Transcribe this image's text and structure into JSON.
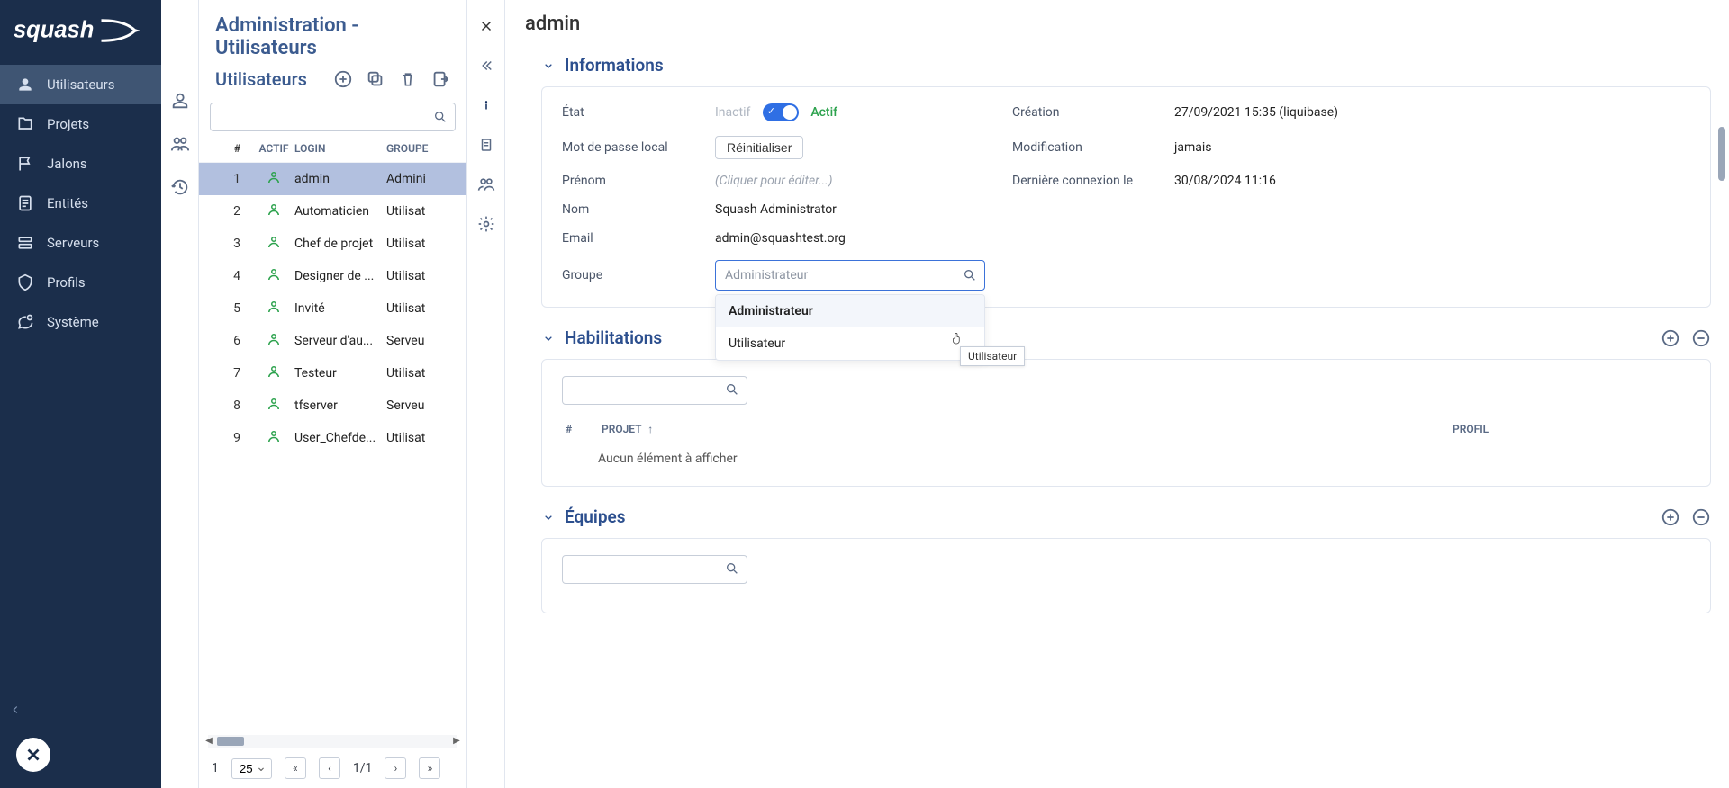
{
  "nav": {
    "items": [
      {
        "label": "Utilisateurs",
        "active": true
      },
      {
        "label": "Projets"
      },
      {
        "label": "Jalons"
      },
      {
        "label": "Entités"
      },
      {
        "label": "Serveurs"
      },
      {
        "label": "Profils"
      },
      {
        "label": "Système"
      }
    ]
  },
  "list": {
    "title": "Administration - Utilisateurs",
    "subtitle": "Utilisateurs",
    "columns": {
      "num": "#",
      "actif": "ACTIF",
      "login": "LOGIN",
      "groupe": "GROUPE"
    },
    "rows": [
      {
        "n": "1",
        "login": "admin",
        "groupe": "Admini",
        "selected": true
      },
      {
        "n": "2",
        "login": "Automaticien",
        "groupe": "Utilisat"
      },
      {
        "n": "3",
        "login": "Chef de projet",
        "groupe": "Utilisat"
      },
      {
        "n": "4",
        "login": "Designer de ...",
        "groupe": "Utilisat"
      },
      {
        "n": "5",
        "login": "Invité",
        "groupe": "Utilisat"
      },
      {
        "n": "6",
        "login": "Serveur d'au...",
        "groupe": "Serveu"
      },
      {
        "n": "7",
        "login": "Testeur",
        "groupe": "Utilisat"
      },
      {
        "n": "8",
        "login": "tfserver",
        "groupe": "Serveu"
      },
      {
        "n": "9",
        "login": "User_Chefde...",
        "groupe": "Utilisat"
      }
    ],
    "pager": {
      "pos": "1",
      "size": "25",
      "page": "1/1"
    }
  },
  "detail": {
    "title": "admin",
    "sections": {
      "info": {
        "heading": "Informations",
        "fields": {
          "etat_label": "État",
          "inactif": "Inactif",
          "actif": "Actif",
          "mdp_label": "Mot de passe local",
          "reset": "Réinitialiser",
          "prenom_label": "Prénom",
          "prenom_placeholder": "(Cliquer pour éditer...)",
          "nom_label": "Nom",
          "nom_value": "Squash Administrator",
          "email_label": "Email",
          "email_value": "admin@squashtest.org",
          "groupe_label": "Groupe",
          "groupe_placeholder": "Administrateur",
          "creation_label": "Création",
          "creation_value": "27/09/2021 15:35 (liquibase)",
          "modif_label": "Modification",
          "modif_value": "jamais",
          "lastconn_label": "Dernière connexion le",
          "lastconn_value": "30/08/2024 11:16"
        },
        "dropdown": {
          "opt1": "Administrateur",
          "opt2": "Utilisateur",
          "tooltip": "Utilisateur"
        }
      },
      "hab": {
        "heading": "Habilitations",
        "columns": {
          "num": "#",
          "projet": "PROJET",
          "profil": "PROFIL"
        },
        "empty": "Aucun élément à afficher"
      },
      "equipes": {
        "heading": "Équipes"
      }
    }
  }
}
